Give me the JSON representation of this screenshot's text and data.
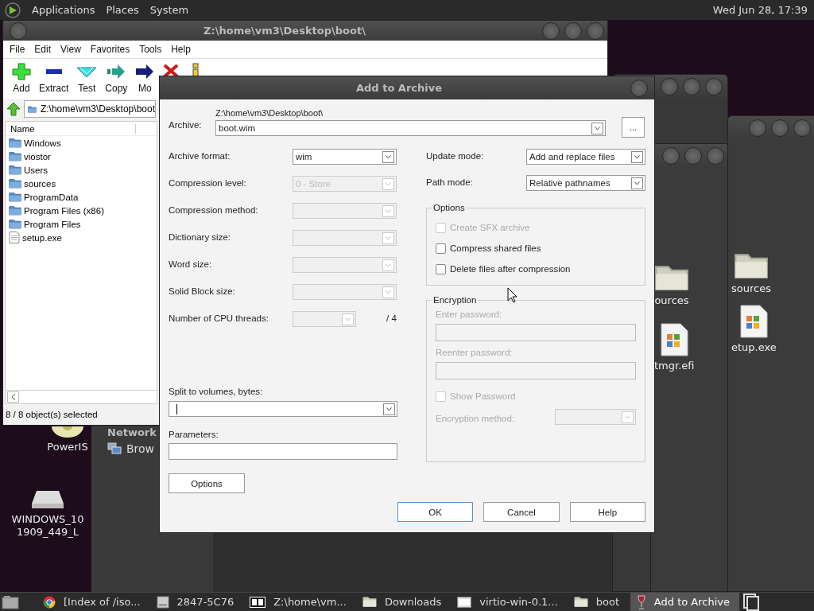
{
  "top_panel": {
    "menus": [
      "Applications",
      "Places",
      "System"
    ],
    "clock": "Wed Jun 28, 17:39"
  },
  "desktop_icons": [
    {
      "kind": "disc",
      "label_lines": [
        "PowerIS"
      ]
    },
    {
      "kind": "drive",
      "label_lines": [
        "WINDOWS_10",
        "1909_449_L"
      ]
    }
  ],
  "network_window": {
    "heading": "Network",
    "items": [
      "Brow"
    ]
  },
  "folder_windows": [
    {
      "icons": [
        {
          "kind": "folder",
          "label": "ources"
        },
        {
          "kind": "file",
          "label": "tmgr.efi"
        }
      ]
    },
    {
      "icons": [
        {
          "kind": "folder",
          "label": "sources"
        },
        {
          "kind": "file",
          "label": "etup.exe"
        }
      ]
    }
  ],
  "file_manager": {
    "title": "Z:\\home\\vm3\\Desktop\\boot\\",
    "menu": [
      "File",
      "Edit",
      "View",
      "Favorites",
      "Tools",
      "Help"
    ],
    "toolbar": [
      {
        "kind": "add",
        "label": "Add"
      },
      {
        "kind": "extract",
        "label": "Extract"
      },
      {
        "kind": "test",
        "label": "Test"
      },
      {
        "kind": "copy",
        "label": "Copy"
      },
      {
        "kind": "move",
        "label": "Mo"
      },
      {
        "kind": "delete"
      },
      {
        "kind": "info"
      }
    ],
    "address": "Z:\\home\\vm3\\Desktop\\boot",
    "column": "Name",
    "files": [
      {
        "kind": "folder",
        "name": "Windows"
      },
      {
        "kind": "folder",
        "name": "viostor"
      },
      {
        "kind": "folder",
        "name": "Users"
      },
      {
        "kind": "folder",
        "name": "sources"
      },
      {
        "kind": "folder",
        "name": "ProgramData"
      },
      {
        "kind": "folder",
        "name": "Program Files (x86)"
      },
      {
        "kind": "folder",
        "name": "Program Files"
      },
      {
        "kind": "file",
        "name": "setup.exe"
      }
    ],
    "status": "8 / 8 object(s) selected"
  },
  "dialog": {
    "title": "Add to Archive",
    "archive": {
      "label": "Archive:",
      "path": "Z:\\home\\vm3\\Desktop\\boot\\",
      "value": "boot.wim",
      "browse": "..."
    },
    "left_fields": [
      {
        "label": "Archive format:",
        "value": "wim",
        "disabled": false
      },
      {
        "label": "Compression level:",
        "value": "0 - Store",
        "disabled": true
      },
      {
        "label": "Compression method:",
        "disabled": true
      },
      {
        "label": "Dictionary size:",
        "disabled": true
      },
      {
        "label": "Word size:",
        "disabled": true
      },
      {
        "label": "Solid Block size:",
        "disabled": true
      },
      {
        "label": "Number of CPU threads:",
        "disabled": true,
        "suffix": "/ 4"
      }
    ],
    "split": {
      "label": "Split to volumes, bytes:"
    },
    "parameters": {
      "label": "Parameters:"
    },
    "options_button": "Options",
    "right_fields": [
      {
        "label": "Update mode:",
        "value": "Add and replace files"
      },
      {
        "label": "Path mode:",
        "value": "Relative pathnames"
      }
    ],
    "options_group": {
      "title": "Options",
      "checks": [
        {
          "label": "Create SFX archive",
          "checked": false,
          "disabled": true
        },
        {
          "label": "Compress shared files",
          "checked": false,
          "disabled": false
        },
        {
          "label": "Delete files after compression",
          "checked": false,
          "disabled": false
        }
      ]
    },
    "encryption": {
      "title": "Encryption",
      "disabled": true,
      "fields": [
        "Enter password:",
        "Reenter password:"
      ],
      "show_password": {
        "label": "Show Password",
        "checked": false
      },
      "method_label": "Encryption method:"
    },
    "buttons": [
      {
        "label": "OK",
        "default": true
      },
      {
        "label": "Cancel",
        "default": false
      },
      {
        "label": "Help",
        "default": false
      }
    ]
  },
  "taskbar": {
    "items": [
      {
        "kind": "browser",
        "label": "[Index of /iso...",
        "selected": false
      },
      {
        "kind": "disk",
        "label": "2847-5C76",
        "selected": false
      },
      {
        "kind": "archiver",
        "label": "Z:\\home\\vm...",
        "selected": false
      },
      {
        "kind": "folder",
        "label": "Downloads",
        "selected": false
      },
      {
        "kind": "terminal",
        "label": "virtio-win-0.1...",
        "selected": false
      },
      {
        "kind": "folder",
        "label": "boot",
        "selected": false
      },
      {
        "kind": "wine",
        "label": "Add to Archive",
        "selected": true
      }
    ]
  }
}
